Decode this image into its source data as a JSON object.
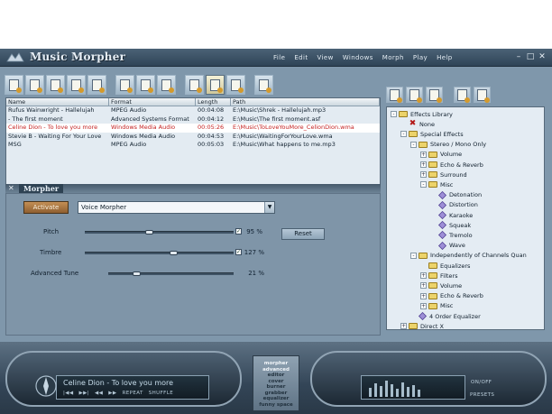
{
  "app": {
    "title": "Music Morpher",
    "menu": [
      "File",
      "Edit",
      "View",
      "Windows",
      "Morph",
      "Play",
      "Help"
    ],
    "window_controls": [
      "minimize-icon",
      "maximize-icon",
      "close-icon"
    ]
  },
  "toolbar": {
    "buttons": [
      "add-files-icon",
      "open-icon",
      "save-icon",
      "save-as-icon",
      "record-icon",
      "copy-icon",
      "paste-icon",
      "delete-icon",
      "playlist-icon",
      "morpher-icon",
      "voice-icon",
      "export-icon"
    ],
    "active_index": 9
  },
  "filelist": {
    "headers": [
      "Name",
      "Format",
      "Length",
      "Path"
    ],
    "rows": [
      {
        "name": "Rufus Wainwright - Hallelujah",
        "format": "MPEG Audio",
        "length": "00:04:08",
        "path": "E:\\Music\\Shrek - Hallelujah.mp3"
      },
      {
        "name": "- The first moment",
        "format": "Advanced Systems Format",
        "length": "00:04:12",
        "path": "E:\\Music\\The first moment.asf"
      },
      {
        "name": "Celine Dion - To love you more",
        "format": "Windows Media Audio",
        "length": "00:05:26",
        "path": "E:\\Music\\ToLoveYouMore_CelionDion.wma"
      },
      {
        "name": "Stevie B - Waiting For Your Love",
        "format": "Windows Media Audio",
        "length": "00:04:53",
        "path": "E:\\Music\\WaitingForYourLove.wma"
      },
      {
        "name": "MSG",
        "format": "MPEG Audio",
        "length": "00:05:03",
        "path": "E:\\Music\\What happens to me.mp3"
      }
    ],
    "selected_index": 2
  },
  "morpher": {
    "title": "Morpher",
    "activate_label": "Activate",
    "preset": "Voice Morpher",
    "reset_label": "Reset",
    "params": [
      {
        "label": "Pitch",
        "value": "95 %",
        "fraction": 0.43,
        "checked": true
      },
      {
        "label": "Timbre",
        "value": "127 %",
        "fraction": 0.6,
        "checked": true
      },
      {
        "label": "Advanced Tune",
        "value": "21 %",
        "fraction": 0.21,
        "checked": false
      }
    ]
  },
  "effects": {
    "toolbar": [
      "add-effect-icon",
      "edit-effect-icon",
      "delete-effect-icon",
      "import-icon",
      "export-icon"
    ],
    "tree": [
      {
        "label": "Effects Library",
        "depth": 0,
        "kind": "folder",
        "toggle": "-"
      },
      {
        "label": "None",
        "depth": 1,
        "kind": "none",
        "toggle": ""
      },
      {
        "label": "Special Effects",
        "depth": 1,
        "kind": "folder",
        "toggle": "-"
      },
      {
        "label": "Stereo / Mono Only",
        "depth": 2,
        "kind": "folder",
        "toggle": "-"
      },
      {
        "label": "Volume",
        "depth": 3,
        "kind": "folder",
        "toggle": "+"
      },
      {
        "label": "Echo & Reverb",
        "depth": 3,
        "kind": "folder",
        "toggle": "+"
      },
      {
        "label": "Surround",
        "depth": 3,
        "kind": "folder",
        "toggle": "+"
      },
      {
        "label": "Misc",
        "depth": 3,
        "kind": "folder",
        "toggle": "-"
      },
      {
        "label": "Detonation",
        "depth": 4,
        "kind": "effect",
        "toggle": ""
      },
      {
        "label": "Distortion",
        "depth": 4,
        "kind": "effect",
        "toggle": ""
      },
      {
        "label": "Karaoke",
        "depth": 4,
        "kind": "effect",
        "toggle": ""
      },
      {
        "label": "Squeak",
        "depth": 4,
        "kind": "effect",
        "toggle": ""
      },
      {
        "label": "Tremolo",
        "depth": 4,
        "kind": "effect",
        "toggle": ""
      },
      {
        "label": "Wave",
        "depth": 4,
        "kind": "effect",
        "toggle": ""
      },
      {
        "label": "Independently of Channels Quan",
        "depth": 2,
        "kind": "folder",
        "toggle": "-"
      },
      {
        "label": "Equalizers",
        "depth": 3,
        "kind": "folder",
        "toggle": ""
      },
      {
        "label": "Filters",
        "depth": 3,
        "kind": "folder",
        "toggle": "+"
      },
      {
        "label": "Volume",
        "depth": 3,
        "kind": "folder",
        "toggle": "+"
      },
      {
        "label": "Echo & Reverb",
        "depth": 3,
        "kind": "folder",
        "toggle": "+"
      },
      {
        "label": "Misc",
        "depth": 3,
        "kind": "folder",
        "toggle": "+"
      },
      {
        "label": "4 Order Equalizer",
        "depth": 2,
        "kind": "effect",
        "toggle": ""
      },
      {
        "label": "Direct X",
        "depth": 1,
        "kind": "folder",
        "toggle": "+"
      }
    ]
  },
  "player": {
    "now_playing": "Celine Dion - To love you more",
    "transport": [
      "|◀◀",
      "▶▶|",
      "◀◀",
      "▶▶",
      "REPEAT",
      "SHUFFLE"
    ],
    "modes": [
      "morpher",
      "advanced",
      "editor",
      "cover",
      "burner",
      "grabber",
      "equalizer",
      "funny space"
    ],
    "active_modes": [
      0,
      1
    ],
    "onoff_label": "ON/OFF",
    "presets_label": "PRESETS",
    "eq_levels": [
      0.5,
      0.75,
      0.6,
      0.9,
      0.7,
      0.45,
      0.8,
      0.55,
      0.65,
      0.4
    ]
  }
}
